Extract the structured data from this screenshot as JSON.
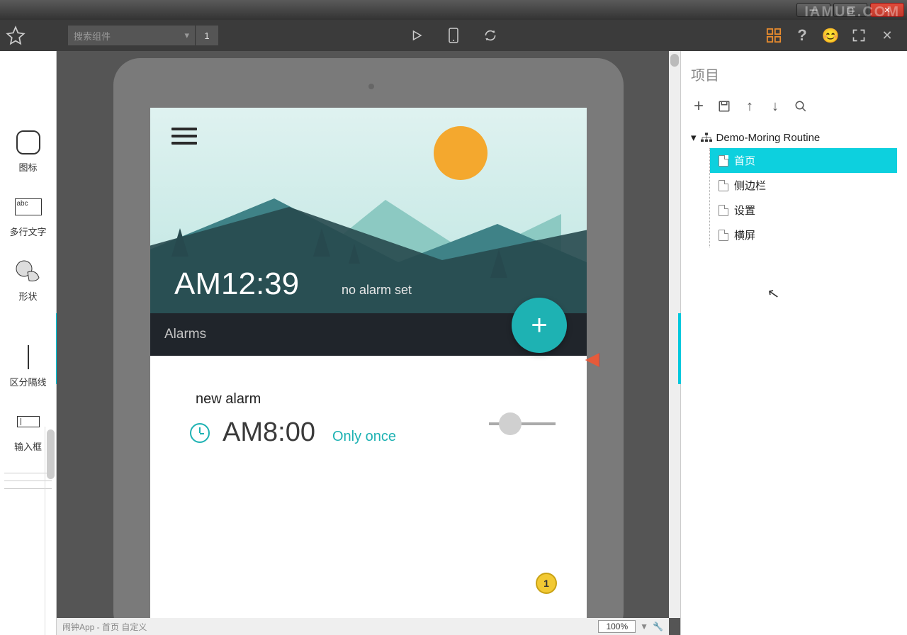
{
  "window": {
    "watermark": "IAMUE.COM"
  },
  "toolbar": {
    "search_placeholder": "搜索组件",
    "search_count": "1"
  },
  "left_panel": {
    "items": [
      {
        "label": "图标"
      },
      {
        "label": "多行文字"
      },
      {
        "label": "形状"
      },
      {
        "label": "区分隔线"
      },
      {
        "label": "输入框"
      }
    ]
  },
  "mockup": {
    "hero_time": "AM12:39",
    "hero_subtitle": "no alarm set",
    "alarms_header": "Alarms",
    "new_alarm_label": "new alarm",
    "alarm_time": "AM8:00",
    "alarm_repeat": "Only once",
    "badge_count": "1"
  },
  "status_bar": {
    "breadcrumb": "闹钟App - 首页 自定义",
    "zoom": "100%"
  },
  "right_panel": {
    "title": "项目",
    "root": "Demo-Moring Routine",
    "pages": [
      {
        "label": "首页",
        "selected": true
      },
      {
        "label": "侧边栏",
        "selected": false
      },
      {
        "label": "设置",
        "selected": false
      },
      {
        "label": "横屏",
        "selected": false
      }
    ]
  }
}
